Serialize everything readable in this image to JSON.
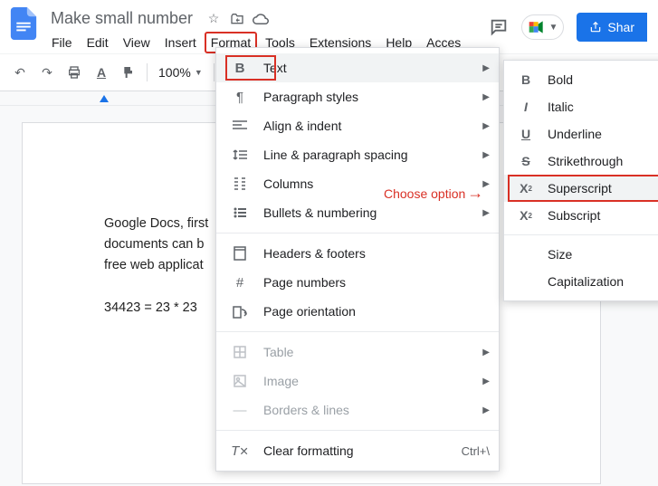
{
  "doc": {
    "title": "Make small number",
    "body_line1": "Google Docs, first",
    "body_line2": "documents can b",
    "body_line3": "free web applicat",
    "body_line4": "34423 =  23 * 23"
  },
  "menubar": [
    "File",
    "Edit",
    "View",
    "Insert",
    "Format",
    "Tools",
    "Extensions",
    "Help",
    "Acces"
  ],
  "toolbar": {
    "zoom": "100%"
  },
  "share_label": "Shar",
  "format_menu": {
    "text": "Text",
    "paragraph_styles": "Paragraph styles",
    "align_indent": "Align & indent",
    "line_spacing": "Line & paragraph spacing",
    "columns": "Columns",
    "bullets": "Bullets & numbering",
    "headers_footers": "Headers & footers",
    "page_numbers": "Page numbers",
    "page_orientation": "Page orientation",
    "table": "Table",
    "image": "Image",
    "borders_lines": "Borders & lines",
    "clear_formatting": "Clear formatting",
    "clear_shortcut": "Ctrl+\\"
  },
  "text_submenu": {
    "bold": "Bold",
    "italic": "Italic",
    "underline": "Underline",
    "strikethrough": "Strikethrough",
    "superscript": "Superscript",
    "subscript": "Subscript",
    "size": "Size",
    "capitalization": "Capitalization"
  },
  "annotation": "Choose option"
}
